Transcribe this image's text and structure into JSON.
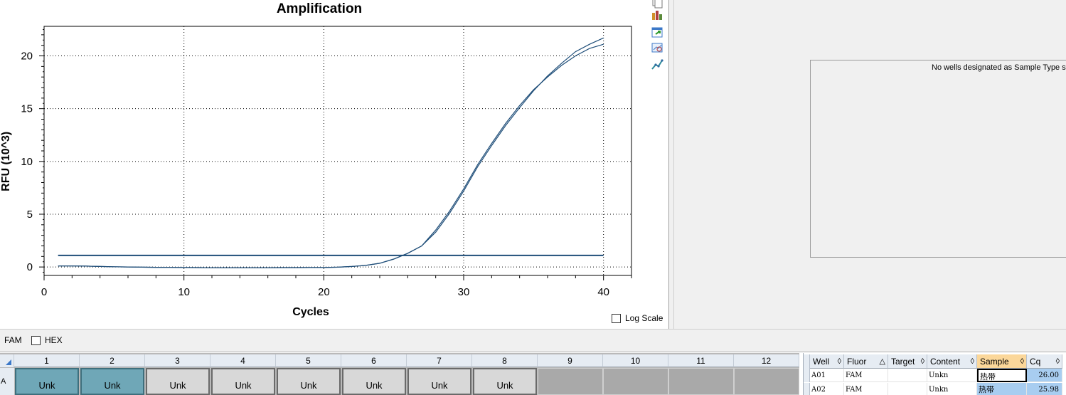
{
  "chart_data": {
    "type": "line",
    "title": "Amplification",
    "xlabel": "Cycles",
    "ylabel": "RFU (10^3)",
    "xlim": [
      0,
      42
    ],
    "ylim": [
      -0.8,
      22.8
    ],
    "xticks": [
      0,
      10,
      20,
      30,
      40
    ],
    "yticks": [
      0,
      5,
      10,
      15,
      20
    ],
    "grid": true,
    "series": [
      {
        "x": [
          1,
          2,
          3,
          4,
          5,
          6,
          7,
          8,
          9,
          10,
          11,
          12,
          13,
          14,
          15,
          16,
          17,
          18,
          19,
          20,
          21,
          22,
          23,
          24,
          25,
          26,
          27,
          28,
          29,
          30,
          31,
          32,
          33,
          34,
          35,
          36,
          37,
          38,
          39,
          40
        ],
        "values": [
          0.1,
          0.1,
          0.08,
          0.05,
          0.02,
          0.0,
          -0.02,
          -0.03,
          -0.04,
          -0.05,
          -0.06,
          -0.07,
          -0.07,
          -0.07,
          -0.07,
          -0.07,
          -0.06,
          -0.06,
          -0.05,
          -0.05,
          -0.02,
          0.05,
          0.15,
          0.35,
          0.75,
          1.3,
          2.0,
          3.5,
          5.3,
          7.4,
          9.7,
          11.7,
          13.6,
          15.3,
          16.8,
          18.0,
          19.1,
          20.0,
          20.7,
          21.1
        ]
      },
      {
        "x": [
          1,
          2,
          3,
          4,
          5,
          6,
          7,
          8,
          9,
          10,
          11,
          12,
          13,
          14,
          15,
          16,
          17,
          18,
          19,
          20,
          21,
          22,
          23,
          24,
          25,
          26,
          27,
          28,
          29,
          30,
          31,
          32,
          33,
          34,
          35,
          36,
          37,
          38,
          39,
          40
        ],
        "values": [
          0.1,
          0.1,
          0.08,
          0.05,
          0.02,
          0.0,
          -0.02,
          -0.03,
          -0.04,
          -0.05,
          -0.06,
          -0.07,
          -0.07,
          -0.07,
          -0.07,
          -0.07,
          -0.06,
          -0.06,
          -0.05,
          -0.05,
          -0.02,
          0.05,
          0.15,
          0.35,
          0.75,
          1.3,
          2.0,
          3.3,
          5.1,
          7.2,
          9.5,
          11.5,
          13.4,
          15.1,
          16.7,
          18.1,
          19.3,
          20.4,
          21.1,
          21.7
        ]
      }
    ],
    "threshold": 1.1
  },
  "colors": {
    "curve": "#1f4e79",
    "threshold": "#1f4e79",
    "selected_well": "#6fa7b7"
  },
  "toolbar_icons": [
    "copy-icon",
    "chart-settings-icon",
    "export-icon",
    "zoom-icon",
    "curve-icon"
  ],
  "log_scale": {
    "label": "Log Scale",
    "checked": false
  },
  "std_curve": {
    "message": "No wells designated as Sample Type sta"
  },
  "fluors": [
    {
      "label": "FAM"
    },
    {
      "label": "HEX",
      "checked": false
    }
  ],
  "plate": {
    "columns": [
      "1",
      "2",
      "3",
      "4",
      "5",
      "6",
      "7",
      "8",
      "9",
      "10",
      "11",
      "12"
    ],
    "row_label": "A",
    "wells": [
      "Unk",
      "Unk",
      "Unk",
      "Unk",
      "Unk",
      "Unk",
      "Unk",
      "Unk",
      "",
      "",
      "",
      ""
    ]
  },
  "table": {
    "headers": [
      "Well",
      "Fluor",
      "Target",
      "Content",
      "Sample",
      "Cq"
    ],
    "sort_glyphs": [
      "◊",
      "△",
      "◊",
      "◊",
      "◊",
      "◊"
    ],
    "rows": [
      [
        "A01",
        "FAM",
        "",
        "Unkn",
        "热带",
        "26.00"
      ],
      [
        "A02",
        "FAM",
        "",
        "Unkn",
        "热带",
        "25.98"
      ]
    ]
  }
}
